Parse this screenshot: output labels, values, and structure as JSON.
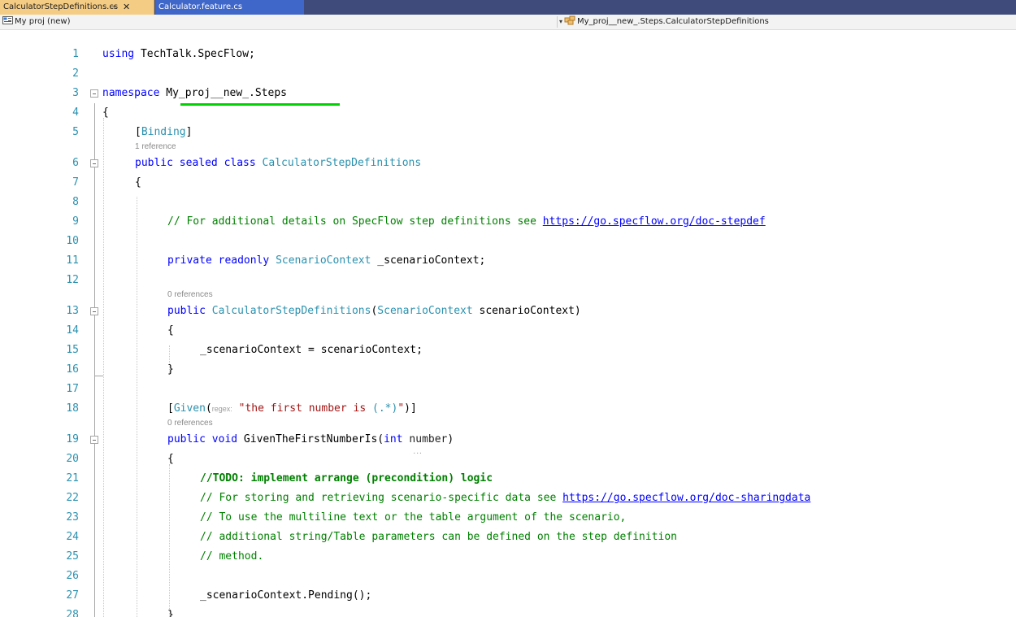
{
  "tabs": [
    {
      "title": "CalculatorStepDefinitions.cs",
      "pin_icon": "pin-icon",
      "close_icon": "close-icon"
    },
    {
      "title": "Calculator.feature.cs"
    }
  ],
  "navbar": {
    "project": "My proj (new)",
    "type_name": "My_proj__new_.Steps.CalculatorStepDefinitions",
    "project_icon": "csharp-project-icon",
    "type_icon": "class-icon"
  },
  "editor": {
    "lines": {
      "l1": {
        "n": "1",
        "using_kw": "using",
        "rest": " TechTalk.SpecFlow;"
      },
      "l2": {
        "n": "2"
      },
      "l3": {
        "n": "3",
        "kw": "namespace",
        "name": " My_proj__new_.Steps"
      },
      "l4": {
        "n": "4",
        "text": "{"
      },
      "l5": {
        "n": "5",
        "open": "[",
        "attr": "Binding",
        "close": "]"
      },
      "l6": {
        "n": "6",
        "kw": "public sealed class",
        "name": "CalculatorStepDefinitions"
      },
      "l7": {
        "n": "7",
        "text": "{"
      },
      "l8": {
        "n": "8"
      },
      "l9": {
        "n": "9",
        "comment": "// For additional details on SpecFlow step definitions see ",
        "link": "https://go.specflow.org/doc-stepdef"
      },
      "l10": {
        "n": "10"
      },
      "l11": {
        "n": "11",
        "kw": "private readonly",
        "type": "ScenarioContext",
        "rest": " _scenarioContext;"
      },
      "l12": {
        "n": "12"
      },
      "l13": {
        "n": "13",
        "kw": "public",
        "type1": "CalculatorStepDefinitions",
        "mid": "(",
        "type2": "ScenarioContext",
        "rest": " scenarioContext)"
      },
      "l14": {
        "n": "14",
        "text": "{"
      },
      "l15": {
        "n": "15",
        "text": "_scenarioContext = scenarioContext;"
      },
      "l16": {
        "n": "16",
        "text": "}"
      },
      "l17": {
        "n": "17"
      },
      "l18": {
        "n": "18",
        "open": "[",
        "attr": "Given",
        "paren": "(",
        "hint": "regex:",
        "str": "\"the first number is ",
        "str_regex": "(.*)",
        "str_end": "\"",
        "close": ")]"
      },
      "l19": {
        "n": "19",
        "kw": "public void",
        "name": " GivenTheFirstNumberIs(",
        "kw2": "int",
        "param": "number",
        "rest": ")"
      },
      "l20": {
        "n": "20",
        "text": "{"
      },
      "l21": {
        "n": "21",
        "todo": "//TODO: implement arrange (precondition) logic"
      },
      "l22": {
        "n": "22",
        "comment": "// For storing and retrieving scenario-specific data see ",
        "link": "https://go.specflow.org/doc-sharingdata"
      },
      "l23": {
        "n": "23",
        "comment": "// To use the multiline text or the table argument of the scenario,"
      },
      "l24": {
        "n": "24",
        "comment": "// additional string/Table parameters can be defined on the step definition"
      },
      "l25": {
        "n": "25",
        "comment": "// method."
      },
      "l26": {
        "n": "26"
      },
      "l27": {
        "n": "27",
        "text": "_scenarioContext.Pending();"
      },
      "l28": {
        "n": "28",
        "text": "}"
      }
    },
    "codelens": {
      "class_refs": "1 reference",
      "ctor_refs": "0 references",
      "method_refs": "0 references"
    }
  },
  "colors": {
    "keyword": "#0000ff",
    "type": "#2b91af",
    "comment": "#008000",
    "string": "#a31515",
    "active_tab": "#f5cc84",
    "tab_bar": "#3f4b7a",
    "highlight_underline": "#00d200"
  }
}
